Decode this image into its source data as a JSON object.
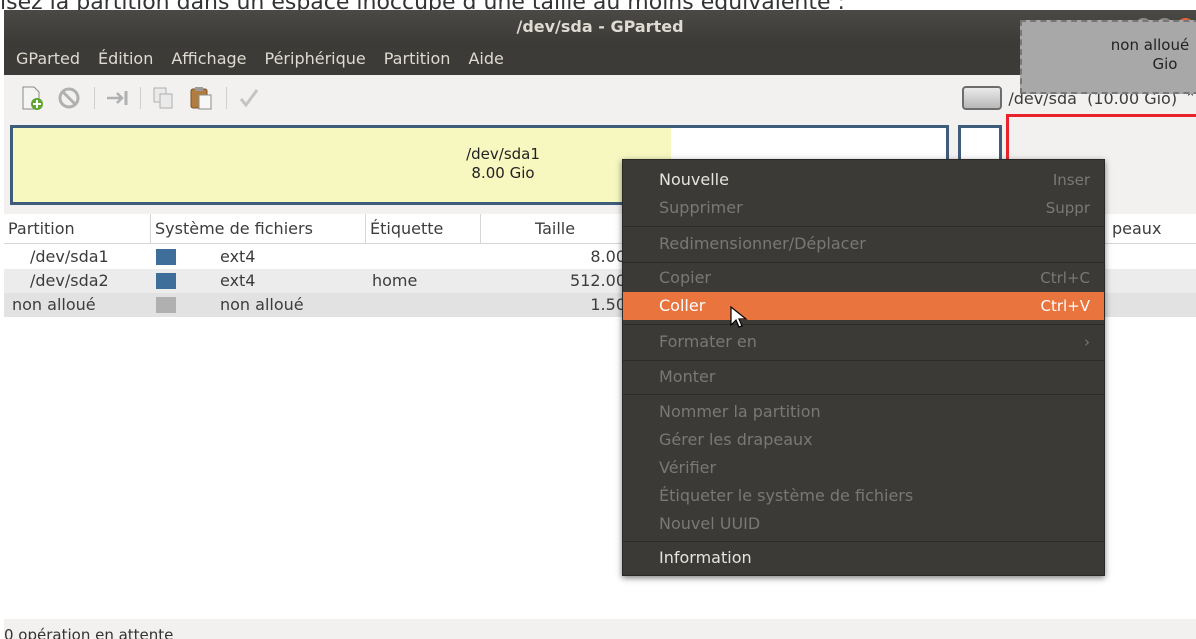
{
  "caption": "isez la partition dans un espace inoccupé d’une taille au moins équivalente :",
  "window": {
    "title": "/dev/sda - GParted"
  },
  "menubar": [
    "GParted",
    "Édition",
    "Affichage",
    "Périphérique",
    "Partition",
    "Aide"
  ],
  "device_selector": {
    "label": "/dev/sda  (10.00 Gio)",
    "arrow": "⌃"
  },
  "partition_bar": {
    "sda1": {
      "name": "/dev/sda1",
      "size": "8.00 Gio"
    },
    "unallocated": {
      "name": "non alloué",
      "size": "Gio"
    }
  },
  "table": {
    "columns": [
      "Partition",
      "Système de fichiers",
      "Étiquette",
      "Taille",
      "Drapeaux"
    ],
    "partial_column": "peaux",
    "rows": [
      {
        "partition": "/dev/sda1",
        "fs": "ext4",
        "label": "",
        "size": "8.00",
        "color": "#3f6e9b"
      },
      {
        "partition": "/dev/sda2",
        "fs": "ext4",
        "label": "home",
        "size": "512.00",
        "color": "#3f6e9b"
      },
      {
        "partition": "non alloué",
        "fs": "non alloué",
        "label": "",
        "size": "1.50",
        "color": "#b0b0b0"
      }
    ]
  },
  "context_menu": {
    "items": [
      {
        "label": "Nouvelle",
        "accel": "Inser",
        "state": "enabled"
      },
      {
        "label": "Supprimer",
        "accel": "Suppr",
        "state": "disabled"
      },
      {
        "label": "Redimensionner/Déplacer",
        "accel": "",
        "state": "disabled"
      },
      {
        "label": "Copier",
        "accel": "Ctrl+C",
        "state": "disabled"
      },
      {
        "label": "Coller",
        "accel": "Ctrl+V",
        "state": "active"
      },
      {
        "label": "Formater en",
        "accel": "›",
        "state": "disabled"
      },
      {
        "label": "Monter",
        "accel": "",
        "state": "disabled"
      },
      {
        "label": "Nommer la partition",
        "accel": "",
        "state": "disabled"
      },
      {
        "label": "Gérer les drapeaux",
        "accel": "",
        "state": "disabled"
      },
      {
        "label": "Vérifier",
        "accel": "",
        "state": "disabled"
      },
      {
        "label": "Étiqueter le système de fichiers",
        "accel": "",
        "state": "disabled"
      },
      {
        "label": "Nouvel UUID",
        "accel": "",
        "state": "disabled"
      },
      {
        "label": "Information",
        "accel": "",
        "state": "enabled"
      }
    ]
  },
  "status": "0 opération en attente",
  "colors": {
    "accent": "#e9743d",
    "highlight_box": "#e8232a",
    "partition_border": "#3f5c7a",
    "used_fill": "#f7f7c0",
    "unallocated": "#a8a8a8"
  },
  "icons": [
    "new-icon",
    "delete-icon",
    "resize-icon",
    "copy-icon",
    "paste-icon",
    "apply-icon",
    "disk-icon",
    "mouse-cursor-icon"
  ]
}
